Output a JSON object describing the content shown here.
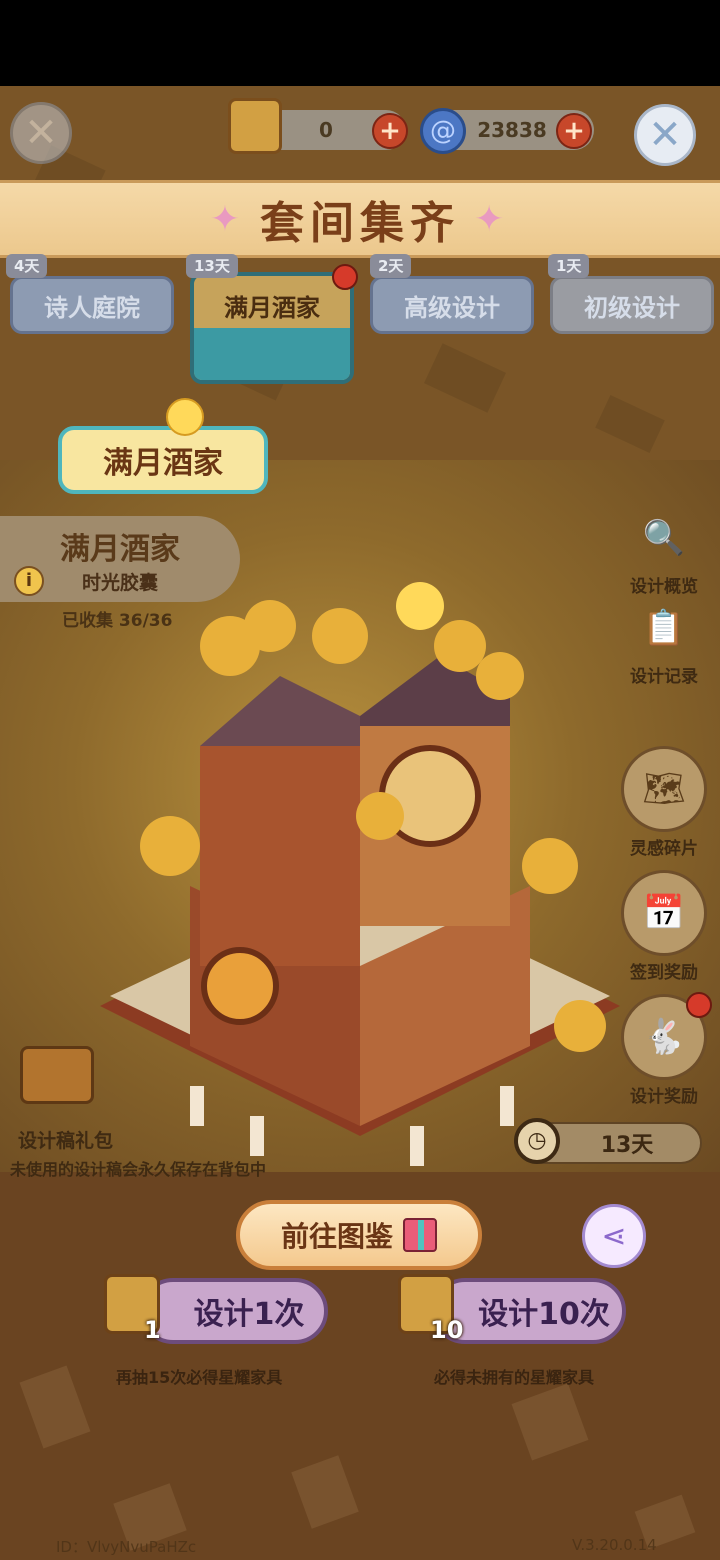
{
  "header": {
    "close_left_icon": "close-icon",
    "scroll_count": "0",
    "spiral_count": "23838",
    "close_right_icon": "close-icon"
  },
  "banner": {
    "title": "套间集齐"
  },
  "tabs": [
    {
      "days": "4天",
      "label": "诗人庭院"
    },
    {
      "days": "13天",
      "label": "满月酒家",
      "active": true
    },
    {
      "days": "2天",
      "label": "高级设计"
    },
    {
      "days": "1天",
      "label": "初级设计"
    }
  ],
  "theme": {
    "badge": "满月酒家"
  },
  "info": {
    "title": "满月酒家",
    "subtitle": "时光胶囊",
    "icon": "i",
    "collected": "已收集 36/36"
  },
  "side_buttons": [
    {
      "label": "设计概览",
      "icon": "magnifier-icon"
    },
    {
      "label": "设计记录",
      "icon": "clipboard-icon"
    },
    {
      "label": "灵感碎片",
      "icon": "map-icon"
    },
    {
      "label": "签到奖励",
      "icon": "calendar-icon"
    },
    {
      "label": "设计奖励",
      "icon": "bunny-icon"
    }
  ],
  "timer": {
    "text": "13天"
  },
  "gift_pack": {
    "label": "设计稿礼包",
    "note": "未使用的设计稿会永久保存在背包中"
  },
  "actions": {
    "goto_label": "前往图鉴",
    "draw1_label": "设计1次",
    "draw1_count": "1",
    "draw1_hint": "再抽15次必得星耀家具",
    "draw10_label": "设计10次",
    "draw10_count": "10",
    "draw10_hint": "必得未拥有的星耀家具"
  },
  "footer": {
    "id": "ID：VlvyNvuPaHZc",
    "version": "V.3.20.0.14"
  },
  "colors": {
    "accent_teal": "#3c9aa3",
    "banner_text": "#7a3f19",
    "badge_red": "#d63a2a"
  }
}
